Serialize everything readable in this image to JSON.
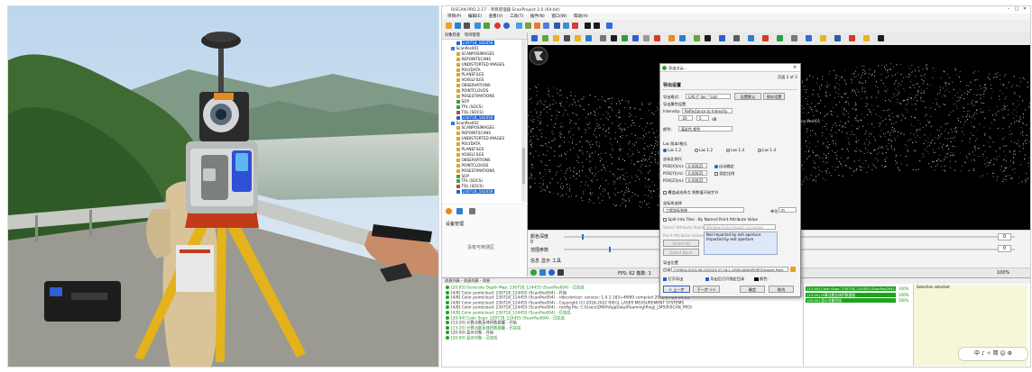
{
  "window": {
    "title": "RiSCAN PRO 2.17 - 项目管理器 ScanProject 2.0 (64-bit)",
    "minimize": "–",
    "maximize": "□",
    "close": "✕"
  },
  "menu": [
    "项目(P)",
    "编辑(E)",
    "查看(V)",
    "工具(T)",
    "插件(N)",
    "窗口(W)",
    "帮助(H)"
  ],
  "tree": {
    "tab_labels": [
      "对象检查",
      "项目管理"
    ],
    "rows": [
      {
        "label": "230718_182658",
        "depth": 2,
        "selected": true,
        "color": "#1e63d6"
      },
      {
        "label": "ScanPos001",
        "depth": 1,
        "selected": false,
        "color": "#2a7fd4"
      },
      {
        "label": "SCANPOSIMAGES",
        "depth": 2,
        "selected": false,
        "color": "#d9a531"
      },
      {
        "label": "REPOINTSCANS",
        "depth": 2,
        "selected": false,
        "color": "#d9a531"
      },
      {
        "label": "UNDISTORTED IMAGES",
        "depth": 2,
        "selected": false,
        "color": "#d9a531"
      },
      {
        "label": "POLYDATA",
        "depth": 2,
        "selected": false,
        "color": "#d9a531"
      },
      {
        "label": "PLANEFILES",
        "depth": 2,
        "selected": false,
        "color": "#d9a531"
      },
      {
        "label": "VOXELFILES",
        "depth": 2,
        "selected": false,
        "color": "#d9a531"
      },
      {
        "label": "OBSERVATIONS",
        "depth": 2,
        "selected": false,
        "color": "#d9a531"
      },
      {
        "label": "POINTCLOUDS",
        "depth": 2,
        "selected": false,
        "color": "#d9a531"
      },
      {
        "label": "POSESTIMATIONS",
        "depth": 2,
        "selected": false,
        "color": "#d9a531"
      },
      {
        "label": "SOP",
        "depth": 2,
        "selected": false,
        "color": "#3f9f3f"
      },
      {
        "label": "TPL (SOCS)",
        "depth": 2,
        "selected": false,
        "color": "#3f9f3f"
      },
      {
        "label": "TOL (SOCS)",
        "depth": 2,
        "selected": false,
        "color": "#d93a3a"
      },
      {
        "label": "230718_182658",
        "depth": 2,
        "selected": true,
        "color": "#1e63d6"
      },
      {
        "label": "ScanPos002",
        "depth": 1,
        "selected": false,
        "color": "#2a7fd4"
      },
      {
        "label": "SCANPOSIMAGES",
        "depth": 2,
        "selected": false,
        "color": "#d9a531"
      },
      {
        "label": "REPOINTSCANS",
        "depth": 2,
        "selected": false,
        "color": "#d9a531"
      },
      {
        "label": "UNDISTORTED IMAGES",
        "depth": 2,
        "selected": false,
        "color": "#d9a531"
      },
      {
        "label": "POLYDATA",
        "depth": 2,
        "selected": false,
        "color": "#d9a531"
      },
      {
        "label": "PLANEFILES",
        "depth": 2,
        "selected": false,
        "color": "#d9a531"
      },
      {
        "label": "VOXELFILES",
        "depth": 2,
        "selected": false,
        "color": "#d9a531"
      },
      {
        "label": "OBSERVATIONS",
        "depth": 2,
        "selected": false,
        "color": "#d9a531"
      },
      {
        "label": "POINTCLOUDS",
        "depth": 2,
        "selected": false,
        "color": "#d9a531"
      },
      {
        "label": "POSESTIMATIONS",
        "depth": 2,
        "selected": false,
        "color": "#d9a531"
      },
      {
        "label": "SOP",
        "depth": 2,
        "selected": false,
        "color": "#3f9f3f"
      },
      {
        "label": "TPL (SOCS)",
        "depth": 2,
        "selected": false,
        "color": "#3f9f3f"
      },
      {
        "label": "TOL (SOCS)",
        "depth": 2,
        "selected": false,
        "color": "#d93a3a"
      },
      {
        "label": "230718_182658",
        "depth": 2,
        "selected": true,
        "color": "#1e63d6"
      }
    ]
  },
  "left_panel": {
    "label1": "设备管理",
    "label2": "没有可用测区"
  },
  "view": {
    "label_scanpos": "ScanPos001"
  },
  "lower": {
    "label1": "颜色深度",
    "label2": "0",
    "label3": "范围参数",
    "value_right1": "0",
    "value_right2": "0",
    "label_info": "信息",
    "label_display": "显示",
    "label_tool": "工具"
  },
  "status": {
    "text": "FPS: 62   像数: 1",
    "zoom": "100%"
  },
  "log": {
    "header": "消息列表 - 消息列表 - 消息",
    "lines": [
      {
        "text": "[20:05] Generate Depth Map: 230718_124455 (ScanPos004) - 已完成",
        "ok": true
      },
      {
        "text": "[4/8] Color pointcloud: 230718_124455 (ScanPos004) - 开始",
        "ok": false
      },
      {
        "text": "[4/8] Color pointcloud: 230718_124455 (ScanPos004) - rdbcolorizer: version: 1.4.1-183+4f690 compiled 2022-07-24 00:03",
        "ok": false
      },
      {
        "text": "[4/8] Color pointcloud: 230718_124455 (ScanPos004) - Copyright (C) 2018-2022 RIEGL LASER MEASUREMENT SYSTEMS",
        "ok": false
      },
      {
        "text": "[4/8] Color pointcloud: 230718_124455 (ScanPos004) - config file: C:\\Users\\DWH\\AppData\\Roaming\\Riegl_LMS\\RiSCAN_PRO\\",
        "ok": false
      },
      {
        "text": "[4/8] Color pointcloud: 230718_124455 (ScanPos004) - 已完成",
        "ok": true
      },
      {
        "text": "[20:44] Color Scan: 230718_124455 (ScanPos004) - 已完成",
        "ok": true
      },
      {
        "text": "[13:20] 计算点数及体积数据量 - 开始",
        "ok": false
      },
      {
        "text": "[13:20] 计算点数及体积数据量 - 已完成",
        "ok": true
      },
      {
        "text": "[20:00] 显示对象 - 开始",
        "ok": false
      },
      {
        "text": "[20:00] 显示对象 - 已完成",
        "ok": true
      }
    ],
    "right_lines": [
      {
        "text": "[12:44] Color Scan: 230718_124455 (ScanPos004) - 已完成",
        "pct": "100%"
      },
      {
        "text": "[13:20] 计算点数及体积数据量",
        "pct": "100%"
      },
      {
        "text": "[20:00] 显示对象完成",
        "pct": "100%"
      }
    ],
    "right_header": "Selection selected"
  },
  "dialog": {
    "title": "导出点云...",
    "page": "页面 2 of 3",
    "heading": "导出设置",
    "format_label": "导出格式:",
    "format_value": "LAS (*.las; *.laz)",
    "format_btn": "设置默认",
    "save_btn": "保存设置",
    "attr_label": "导出属性设置",
    "intensity_label": "Intensity:",
    "intensity_value": "Reflectance to Intensity",
    "range_from": "-20",
    "range_to": "5",
    "range_unit": "dB",
    "color_label": "颜色:",
    "color_value": "真彩色 颜色",
    "las_version_label": "Las 版本/格式",
    "las_options": [
      "Las 1.2",
      "Las 1.2",
      "Las 1.4",
      "Las 1.4"
    ],
    "scale_label": "坐标比例尺",
    "pos_x_label": "POS[X](m):",
    "pos_x": "0.00025",
    "pos_y_label": "POS[Y](m):",
    "pos_y": "0.00025",
    "pos_z_label": "POS[Z](m):",
    "pos_z": "0.00025",
    "auto_label": "自动确定",
    "custom_label": "固定比例",
    "generate_label": "覆盖或选择点 到数值开始字节",
    "coord_label": "坐标系选择",
    "coord_value": "工程坐标系统",
    "unit_label": "单位",
    "unit_value": "m",
    "split_label": "Split Into Files - By Named Point Attribute Value",
    "attr_select_label": "Select Attribute Name:",
    "attr_select_value": "Window Echo Impact Corrected",
    "attr_values_label": "Point Attribute Values:",
    "attr_values": [
      "Not impacted by exit aperture",
      "Impacted by exit aperture"
    ],
    "select_all_btn": "Select All",
    "select_none_btn": "Select None",
    "export_path_label": "导出位置",
    "path_label": "目录:",
    "path_value": "F:\\RIEGL\\2023-06-10\\2023-07-18-1-1\\RISCAN\\EXPORTS\\Export Point Clouds\\",
    "open_after_label": "打开导出",
    "open_folder_label": "导出后打开指定目录",
    "clr_label": "颜色:",
    "back_btn": "< 上一步",
    "next_btn": "下一步 >>",
    "ok_btn": "确定",
    "cancel_btn": "取消"
  },
  "tray": {
    "text": "中 ♪ ✧ 简 ☺ ⚙"
  }
}
